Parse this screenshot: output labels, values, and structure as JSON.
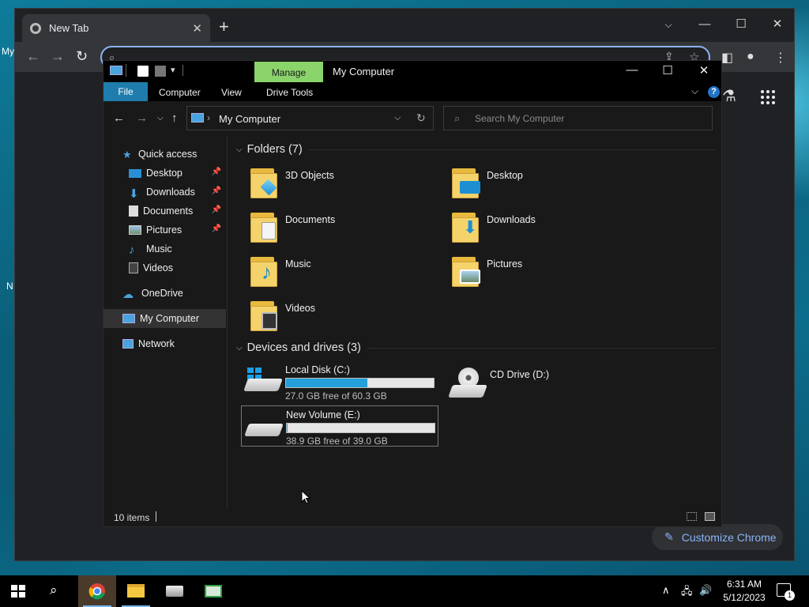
{
  "desktop": {
    "frag_my": "My",
    "frag_n": "N"
  },
  "chrome": {
    "tab_title": "New Tab",
    "tab_close": "✕",
    "new_tab": "+",
    "customize_label": "Customize Chrome"
  },
  "explorer": {
    "manage_tab": "Manage",
    "title": "My Computer",
    "ribbon": {
      "file": "File",
      "computer": "Computer",
      "view": "View",
      "drive_tools": "Drive Tools"
    },
    "address": "My Computer",
    "search_placeholder": "Search My Computer",
    "nav": {
      "quick_access": "Quick access",
      "desktop": "Desktop",
      "downloads": "Downloads",
      "documents": "Documents",
      "pictures": "Pictures",
      "music": "Music",
      "videos": "Videos",
      "onedrive": "OneDrive",
      "my_computer": "My Computer",
      "network": "Network"
    },
    "folders_header": "Folders (7)",
    "folders": [
      "3D Objects",
      "Desktop",
      "Documents",
      "Downloads",
      "Music",
      "Pictures",
      "Videos"
    ],
    "drives_header": "Devices and drives (3)",
    "drives": [
      {
        "name": "Local Disk (C:)",
        "free": "27.0 GB free of 60.3 GB",
        "used_fraction": 0.55
      },
      {
        "name": "CD Drive (D:)"
      },
      {
        "name": "New Volume (E:)",
        "free": "38.9 GB free of 39.0 GB",
        "used_fraction": 0.003
      }
    ],
    "status_count": "10 items"
  },
  "taskbar": {
    "time": "6:31 AM",
    "date": "5/12/2023",
    "notifications": "1"
  },
  "colors": {
    "accent": "#26a0da",
    "manage": "#8bd36b",
    "file_tab": "#1f7dae",
    "chrome_link": "#8ab4f8"
  }
}
